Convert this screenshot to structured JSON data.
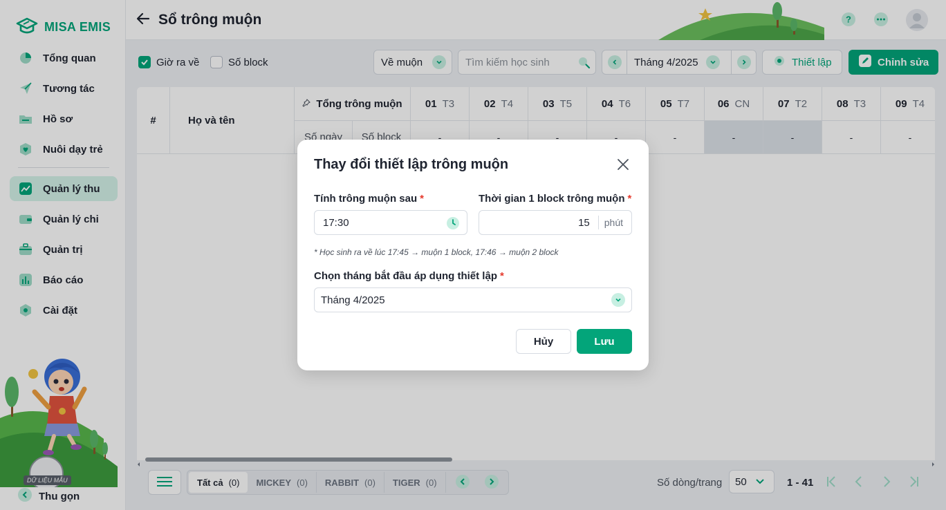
{
  "app": {
    "logo_text": "MISA EMIS"
  },
  "sidebar": {
    "items": [
      {
        "label": "Tổng quan",
        "icon": "pie-chart-icon"
      },
      {
        "label": "Tương tác",
        "icon": "paper-plane-icon"
      },
      {
        "label": "Hồ sơ",
        "icon": "folder-icon"
      },
      {
        "label": "Nuôi dạy trẻ",
        "icon": "heart-icon"
      },
      {
        "label": "Quản lý thu",
        "icon": "trend-chart-icon",
        "active": true
      },
      {
        "label": "Quản lý chi",
        "icon": "wallet-icon"
      },
      {
        "label": "Quản trị",
        "icon": "briefcase-icon"
      },
      {
        "label": "Báo cáo",
        "icon": "bar-chart-icon"
      },
      {
        "label": "Cài đặt",
        "icon": "gear-icon"
      }
    ],
    "collapse_label": "Thu gọn",
    "sample_badge": "DỮ LIỆU MẪU"
  },
  "header": {
    "title": "Sổ trông muộn"
  },
  "toolbar": {
    "checkbox_home_time": {
      "label": "Giờ ra về",
      "checked": true
    },
    "checkbox_blocks": {
      "label": "Số block",
      "checked": false
    },
    "filter_select": "Về muộn",
    "search_placeholder": "Tìm kiếm học sinh",
    "month_value": "Tháng 4/2025",
    "setup_label": "Thiết lập",
    "edit_label": "Chỉnh sửa"
  },
  "table": {
    "col_index": "#",
    "col_name": "Họ và tên",
    "col_total": "Tổng trông muộn",
    "sub_days": "Số ngày",
    "sub_blocks": "Số block",
    "days": [
      {
        "num": "01",
        "dow": "T3",
        "value": "-",
        "weekend": false
      },
      {
        "num": "02",
        "dow": "T4",
        "value": "-",
        "weekend": false
      },
      {
        "num": "03",
        "dow": "T5",
        "value": "-",
        "weekend": false
      },
      {
        "num": "04",
        "dow": "T6",
        "value": "-",
        "weekend": false
      },
      {
        "num": "05",
        "dow": "T7",
        "value": "-",
        "weekend": false
      },
      {
        "num": "06",
        "dow": "CN",
        "value": "-",
        "weekend": true
      },
      {
        "num": "07",
        "dow": "T2",
        "value": "-",
        "weekend": true
      },
      {
        "num": "08",
        "dow": "T3",
        "value": "-",
        "weekend": false
      },
      {
        "num": "09",
        "dow": "T4",
        "value": "-",
        "weekend": false
      }
    ]
  },
  "footer": {
    "tabs": [
      {
        "label": "Tất cả",
        "count": "(0)",
        "active": true
      },
      {
        "label": "MICKEY",
        "count": "(0)",
        "active": false
      },
      {
        "label": "RABBIT",
        "count": "(0)",
        "active": false
      },
      {
        "label": "TIGER",
        "count": "(0)",
        "active": false
      }
    ],
    "rows_per_page_label": "Số dòng/trang",
    "rows_per_page_value": "50",
    "range": "1 - 41"
  },
  "modal": {
    "title": "Thay đổi thiết lập trông muộn",
    "late_after_label": "Tính trông muộn sau",
    "late_after_value": "17:30",
    "block_time_label": "Thời gian 1 block trông muộn",
    "block_time_value": "15",
    "block_time_unit": "phút",
    "hint": "* Học sinh ra về lúc 17:45 → muộn 1 block, 17:46 → muộn 2 block",
    "start_month_label": "Chọn tháng bắt đầu áp dụng thiết lập",
    "start_month_value": "Tháng 4/2025",
    "required_mark": "*",
    "cancel_label": "Hủy",
    "save_label": "Lưu"
  },
  "colors": {
    "accent": "#03a57a",
    "accent_light": "#d5f3ea",
    "required": "#e5392c",
    "weekend_cell": "#dde3ea"
  }
}
